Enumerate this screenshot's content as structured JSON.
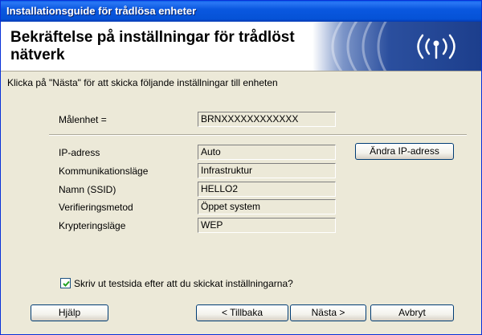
{
  "window": {
    "title": "Installationsguide för trådlösa enheter"
  },
  "header": {
    "heading_line1": "Bekräftelse på inställningar för trådlöst",
    "heading_line2": "nätverk",
    "banner_icon": "wireless-signal-icon"
  },
  "instruction": "Klicka på \"Nästa\" för att skicka följande inställningar till enheten",
  "target": {
    "label": "Målenhet =",
    "value": "BRNXXXXXXXXXXXX"
  },
  "settings": [
    {
      "label": "IP-adress",
      "value": "Auto"
    },
    {
      "label": "Kommunikationsläge",
      "value": "Infrastruktur"
    },
    {
      "label": "Namn (SSID)",
      "value": "HELLO2"
    },
    {
      "label": "Verifieringsmetod",
      "value": "Öppet system"
    },
    {
      "label": "Krypteringsläge",
      "value": "WEP"
    }
  ],
  "change_ip_button": "Ändra IP-adress",
  "print_checkbox": {
    "label": "Skriv ut testsida efter att du skickat inställningarna?",
    "checked": true
  },
  "footer": {
    "help": "Hjälp",
    "back": "< Tillbaka",
    "next": "Nästa >",
    "cancel": "Avbryt"
  },
  "colors": {
    "titlebar": "#0A58E0",
    "banner": "#1C3E8C",
    "dialog_bg": "#ECE9D8"
  }
}
